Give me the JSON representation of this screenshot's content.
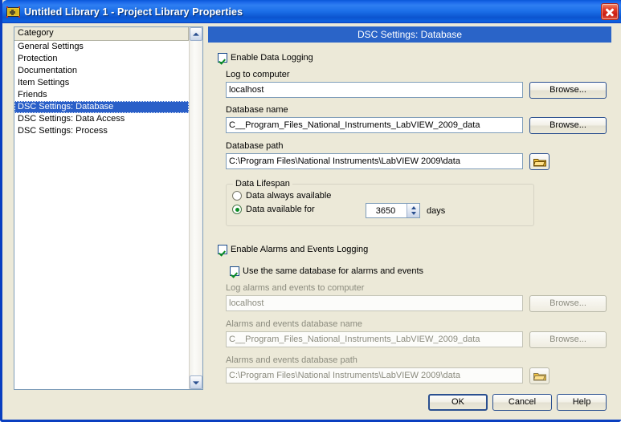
{
  "window": {
    "title": "Untitled Library 1  - Project Library Properties",
    "icon": "labview-library-icon",
    "close_label": "Close"
  },
  "sidebar": {
    "header": "Category",
    "items": [
      {
        "label": "General Settings",
        "selected": false
      },
      {
        "label": "Protection",
        "selected": false
      },
      {
        "label": "Documentation",
        "selected": false
      },
      {
        "label": "Item Settings",
        "selected": false
      },
      {
        "label": "Friends",
        "selected": false
      },
      {
        "label": "DSC Settings: Database",
        "selected": true
      },
      {
        "label": "DSC Settings: Data Access",
        "selected": false
      },
      {
        "label": "DSC Settings: Process",
        "selected": false
      }
    ],
    "scroll_up_icon": "chevron-up-icon",
    "scroll_down_icon": "chevron-down-icon"
  },
  "pane": {
    "header": "DSC Settings: Database",
    "enable_data_logging": {
      "label": "Enable Data Logging",
      "checked": true
    },
    "log_to_computer": {
      "label": "Log to computer",
      "value": "localhost",
      "browse_label": "Browse..."
    },
    "database_name": {
      "label": "Database name",
      "value": "C__Program_Files_National_Instruments_LabVIEW_2009_data",
      "browse_label": "Browse..."
    },
    "database_path": {
      "label": "Database path",
      "value": "C:\\Program Files\\National Instruments\\LabVIEW 2009\\data",
      "browse_icon": "folder-icon"
    },
    "data_lifespan": {
      "title": "Data Lifespan",
      "always_available": {
        "label": "Data always available",
        "selected": false
      },
      "available_for": {
        "label": "Data available for",
        "selected": true,
        "value": "3650",
        "units": "days",
        "up_icon": "spinner-up-icon",
        "down_icon": "spinner-down-icon"
      }
    },
    "enable_alarms_logging": {
      "label": "Enable Alarms and Events Logging",
      "checked": true
    },
    "use_same_database": {
      "label": "Use the same database for alarms and events",
      "checked": true
    },
    "alarms_log_to_computer": {
      "label": "Log alarms and events to computer",
      "value": "localhost",
      "browse_label": "Browse...",
      "disabled": true
    },
    "alarms_database_name": {
      "label": "Alarms and events database name",
      "value": "C__Program_Files_National_Instruments_LabVIEW_2009_data",
      "browse_label": "Browse...",
      "disabled": true
    },
    "alarms_database_path": {
      "label": "Alarms and events database path",
      "value": "C:\\Program Files\\National Instruments\\LabVIEW 2009\\data",
      "browse_icon": "folder-icon",
      "disabled": true
    }
  },
  "footer": {
    "ok_label": "OK",
    "cancel_label": "Cancel",
    "help_label": "Help"
  },
  "colors": {
    "titlebar_blue": "#1966e8",
    "pane_header_blue": "#2a64c8",
    "selection_blue": "#2a5fc8",
    "window_bg": "#ece9d8",
    "check_green": "#0b8c24",
    "close_red": "#c81c13",
    "disabled_text": "#8b8b7e"
  }
}
